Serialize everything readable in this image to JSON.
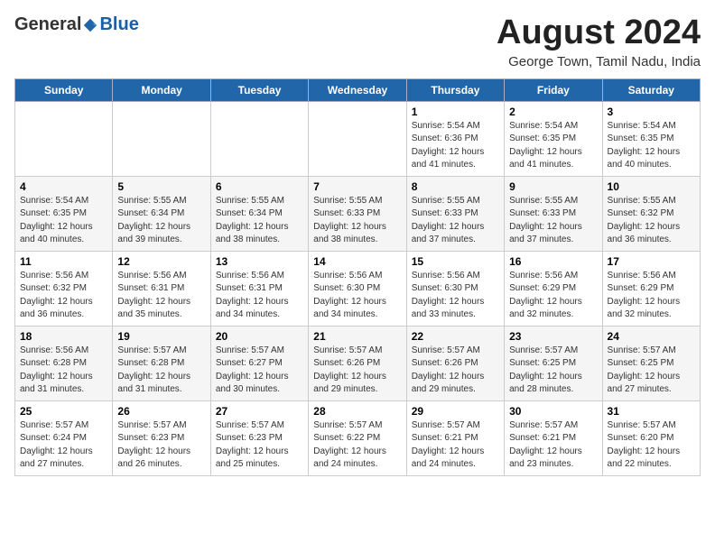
{
  "header": {
    "logo": {
      "general": "General",
      "blue": "Blue"
    },
    "month_title": "August 2024",
    "location": "George Town, Tamil Nadu, India"
  },
  "calendar": {
    "days_of_week": [
      "Sunday",
      "Monday",
      "Tuesday",
      "Wednesday",
      "Thursday",
      "Friday",
      "Saturday"
    ],
    "weeks": [
      [
        {
          "day": "",
          "info": ""
        },
        {
          "day": "",
          "info": ""
        },
        {
          "day": "",
          "info": ""
        },
        {
          "day": "",
          "info": ""
        },
        {
          "day": "1",
          "info": "Sunrise: 5:54 AM\nSunset: 6:36 PM\nDaylight: 12 hours\nand 41 minutes."
        },
        {
          "day": "2",
          "info": "Sunrise: 5:54 AM\nSunset: 6:35 PM\nDaylight: 12 hours\nand 41 minutes."
        },
        {
          "day": "3",
          "info": "Sunrise: 5:54 AM\nSunset: 6:35 PM\nDaylight: 12 hours\nand 40 minutes."
        }
      ],
      [
        {
          "day": "4",
          "info": "Sunrise: 5:54 AM\nSunset: 6:35 PM\nDaylight: 12 hours\nand 40 minutes."
        },
        {
          "day": "5",
          "info": "Sunrise: 5:55 AM\nSunset: 6:34 PM\nDaylight: 12 hours\nand 39 minutes."
        },
        {
          "day": "6",
          "info": "Sunrise: 5:55 AM\nSunset: 6:34 PM\nDaylight: 12 hours\nand 38 minutes."
        },
        {
          "day": "7",
          "info": "Sunrise: 5:55 AM\nSunset: 6:33 PM\nDaylight: 12 hours\nand 38 minutes."
        },
        {
          "day": "8",
          "info": "Sunrise: 5:55 AM\nSunset: 6:33 PM\nDaylight: 12 hours\nand 37 minutes."
        },
        {
          "day": "9",
          "info": "Sunrise: 5:55 AM\nSunset: 6:33 PM\nDaylight: 12 hours\nand 37 minutes."
        },
        {
          "day": "10",
          "info": "Sunrise: 5:55 AM\nSunset: 6:32 PM\nDaylight: 12 hours\nand 36 minutes."
        }
      ],
      [
        {
          "day": "11",
          "info": "Sunrise: 5:56 AM\nSunset: 6:32 PM\nDaylight: 12 hours\nand 36 minutes."
        },
        {
          "day": "12",
          "info": "Sunrise: 5:56 AM\nSunset: 6:31 PM\nDaylight: 12 hours\nand 35 minutes."
        },
        {
          "day": "13",
          "info": "Sunrise: 5:56 AM\nSunset: 6:31 PM\nDaylight: 12 hours\nand 34 minutes."
        },
        {
          "day": "14",
          "info": "Sunrise: 5:56 AM\nSunset: 6:30 PM\nDaylight: 12 hours\nand 34 minutes."
        },
        {
          "day": "15",
          "info": "Sunrise: 5:56 AM\nSunset: 6:30 PM\nDaylight: 12 hours\nand 33 minutes."
        },
        {
          "day": "16",
          "info": "Sunrise: 5:56 AM\nSunset: 6:29 PM\nDaylight: 12 hours\nand 32 minutes."
        },
        {
          "day": "17",
          "info": "Sunrise: 5:56 AM\nSunset: 6:29 PM\nDaylight: 12 hours\nand 32 minutes."
        }
      ],
      [
        {
          "day": "18",
          "info": "Sunrise: 5:56 AM\nSunset: 6:28 PM\nDaylight: 12 hours\nand 31 minutes."
        },
        {
          "day": "19",
          "info": "Sunrise: 5:57 AM\nSunset: 6:28 PM\nDaylight: 12 hours\nand 31 minutes."
        },
        {
          "day": "20",
          "info": "Sunrise: 5:57 AM\nSunset: 6:27 PM\nDaylight: 12 hours\nand 30 minutes."
        },
        {
          "day": "21",
          "info": "Sunrise: 5:57 AM\nSunset: 6:26 PM\nDaylight: 12 hours\nand 29 minutes."
        },
        {
          "day": "22",
          "info": "Sunrise: 5:57 AM\nSunset: 6:26 PM\nDaylight: 12 hours\nand 29 minutes."
        },
        {
          "day": "23",
          "info": "Sunrise: 5:57 AM\nSunset: 6:25 PM\nDaylight: 12 hours\nand 28 minutes."
        },
        {
          "day": "24",
          "info": "Sunrise: 5:57 AM\nSunset: 6:25 PM\nDaylight: 12 hours\nand 27 minutes."
        }
      ],
      [
        {
          "day": "25",
          "info": "Sunrise: 5:57 AM\nSunset: 6:24 PM\nDaylight: 12 hours\nand 27 minutes."
        },
        {
          "day": "26",
          "info": "Sunrise: 5:57 AM\nSunset: 6:23 PM\nDaylight: 12 hours\nand 26 minutes."
        },
        {
          "day": "27",
          "info": "Sunrise: 5:57 AM\nSunset: 6:23 PM\nDaylight: 12 hours\nand 25 minutes."
        },
        {
          "day": "28",
          "info": "Sunrise: 5:57 AM\nSunset: 6:22 PM\nDaylight: 12 hours\nand 24 minutes."
        },
        {
          "day": "29",
          "info": "Sunrise: 5:57 AM\nSunset: 6:21 PM\nDaylight: 12 hours\nand 24 minutes."
        },
        {
          "day": "30",
          "info": "Sunrise: 5:57 AM\nSunset: 6:21 PM\nDaylight: 12 hours\nand 23 minutes."
        },
        {
          "day": "31",
          "info": "Sunrise: 5:57 AM\nSunset: 6:20 PM\nDaylight: 12 hours\nand 22 minutes."
        }
      ]
    ]
  }
}
